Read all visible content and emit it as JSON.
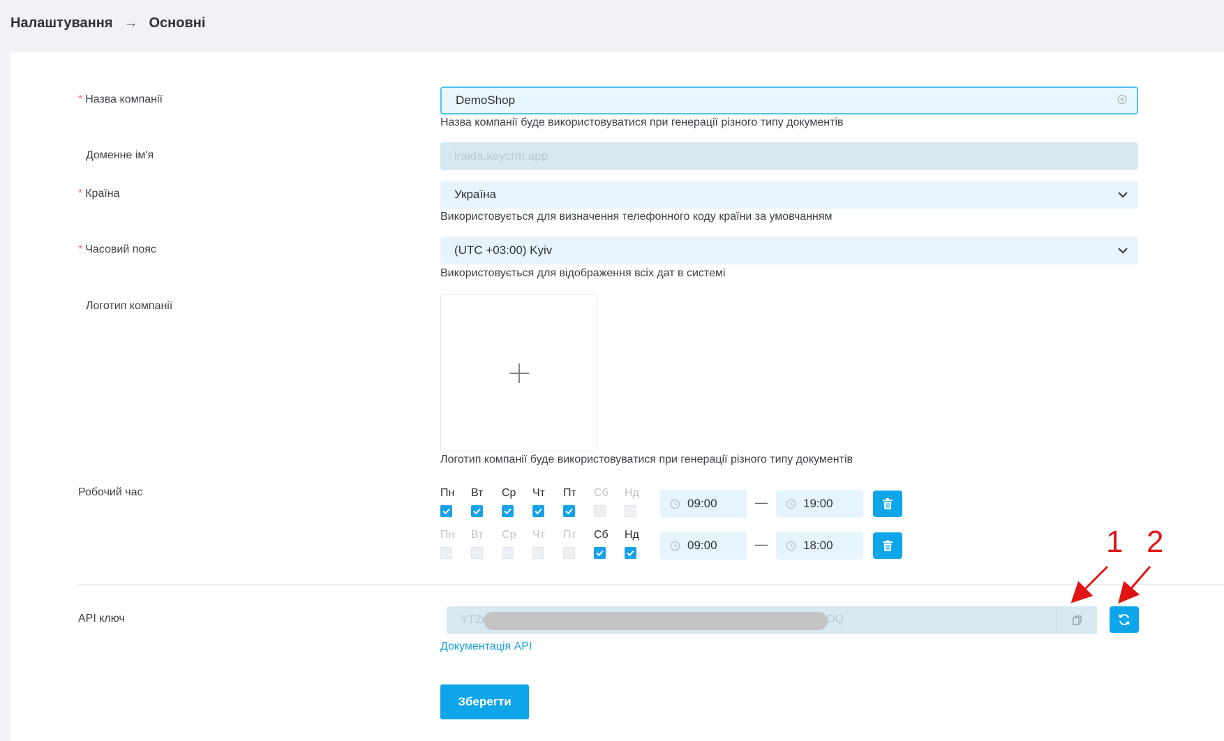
{
  "breadcrumb": {
    "parent": "Налаштування",
    "current": "Основні"
  },
  "form": {
    "company_name": {
      "label": "Назва компанії",
      "value": "DemoShop",
      "hint": "Назва компанії буде використовуватися при генерації різного типу документів"
    },
    "domain": {
      "label": "Доменне ім'я",
      "value": "iraida.keycrm.app"
    },
    "country": {
      "label": "Країна",
      "value": "Україна",
      "hint": "Використовується для визначення телефонного коду країни за умовчанням"
    },
    "timezone": {
      "label": "Часовий пояс",
      "value": "(UTC +03:00) Kyiv",
      "hint": "Використовується для відображення всіх дат в системі"
    },
    "logo": {
      "label": "Логотип компанії",
      "hint": "Логотип компанії буде використовуватися при генерації різного типу документів"
    },
    "work_hours": {
      "label": "Робочий час",
      "schedules": [
        {
          "days": [
            {
              "name": "Пн",
              "checked": true
            },
            {
              "name": "Вт",
              "checked": true
            },
            {
              "name": "Ср",
              "checked": true
            },
            {
              "name": "Чт",
              "checked": true
            },
            {
              "name": "Пт",
              "checked": true
            },
            {
              "name": "Сб",
              "checked": false
            },
            {
              "name": "Нд",
              "checked": false
            }
          ],
          "from": "09:00",
          "to": "19:00"
        },
        {
          "days": [
            {
              "name": "Пн",
              "checked": false
            },
            {
              "name": "Вт",
              "checked": false
            },
            {
              "name": "Ср",
              "checked": false
            },
            {
              "name": "Чт",
              "checked": false
            },
            {
              "name": "Пт",
              "checked": false
            },
            {
              "name": "Сб",
              "checked": true
            },
            {
              "name": "Нд",
              "checked": true
            }
          ],
          "from": "09:00",
          "to": "18:00"
        }
      ],
      "separator": "—"
    },
    "api_key": {
      "label": "API ключ",
      "value_start": "YTZr",
      "value_end": "OQ",
      "doc_link": "Документація API"
    },
    "save_label": "Зберегти"
  },
  "annotations": {
    "label_1": "1",
    "label_2": "2",
    "color": "#e01414"
  },
  "colors": {
    "accent": "#0ea5e9",
    "required": "#f56c6c",
    "field_bg": "#e6f5fd"
  },
  "icons": {
    "clear": "circle-x-icon",
    "select": "chevron-down-icon",
    "upload": "plus-icon",
    "clock": "clock-icon",
    "delete": "trash-icon",
    "copy": "copy-icon",
    "refresh": "refresh-icon",
    "breadcrumb_sep": "arrow-right-icon"
  }
}
